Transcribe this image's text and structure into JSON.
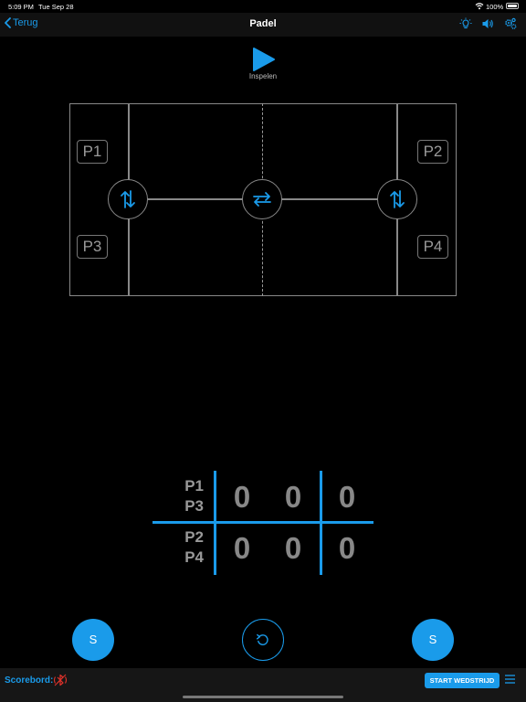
{
  "status_bar": {
    "time": "5:09 PM",
    "date": "Tue Sep 28",
    "battery_pct": "100%"
  },
  "nav": {
    "back_label": "Terug",
    "title": "Padel"
  },
  "play": {
    "label": "Inspelen"
  },
  "court": {
    "players": {
      "p1": "P1",
      "p2": "P2",
      "p3": "P3",
      "p4": "P4"
    }
  },
  "scoreboard": {
    "team1": {
      "line1": "P1",
      "line2": "P3",
      "scores": [
        "0",
        "0",
        "0"
      ]
    },
    "team2": {
      "line1": "P2",
      "line2": "P4",
      "scores": [
        "0",
        "0",
        "0"
      ]
    }
  },
  "buttons": {
    "left_s": "S",
    "right_s": "S"
  },
  "footer": {
    "scoreboard_label": "Scorebord:",
    "start_label": "START WEDSTRIJD"
  },
  "colors": {
    "accent": "#1a9bea",
    "bluetooth_off": "#e0322a",
    "background": "#000000"
  }
}
